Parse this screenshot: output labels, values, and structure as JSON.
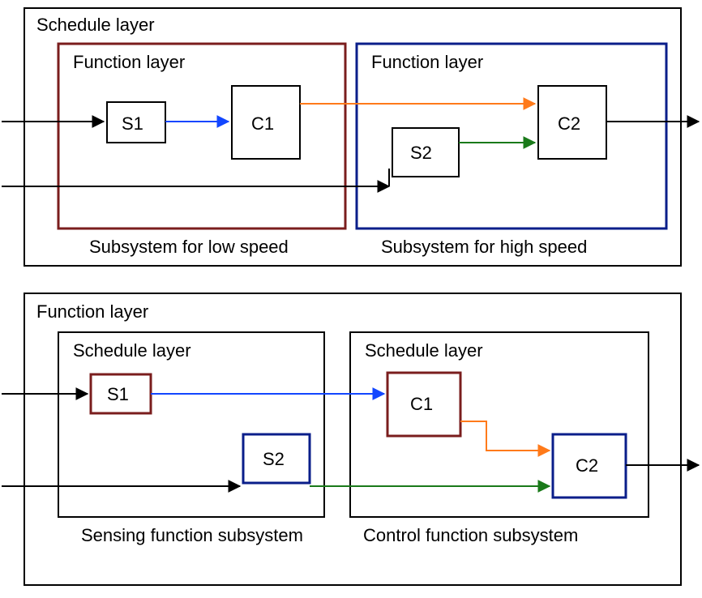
{
  "top": {
    "outer_label": "Schedule layer",
    "left": {
      "inner_label": "Function layer",
      "caption": "Subsystem for low speed",
      "node_s": "S1",
      "node_c": "C1",
      "border_color": "#7a1d1d"
    },
    "right": {
      "inner_label": "Function layer",
      "caption": "Subsystem for high speed",
      "node_s": "S2",
      "node_c": "C2",
      "border_color": "#0a1e8a"
    }
  },
  "bottom": {
    "outer_label": "Function layer",
    "left": {
      "inner_label": "Schedule layer",
      "caption": "Sensing function subsystem",
      "node_a": "S1",
      "node_b": "S2",
      "a_color": "#7a1d1d",
      "b_color": "#0a1e8a"
    },
    "right": {
      "inner_label": "Schedule layer",
      "caption": "Control function subsystem",
      "node_a": "C1",
      "node_b": "C2",
      "a_color": "#7a1d1d",
      "b_color": "#0a1e8a"
    }
  },
  "colors": {
    "black": "#000000",
    "blue_arrow": "#1246ff",
    "orange_arrow": "#ff7a1a",
    "green_arrow": "#1a7a1a"
  }
}
